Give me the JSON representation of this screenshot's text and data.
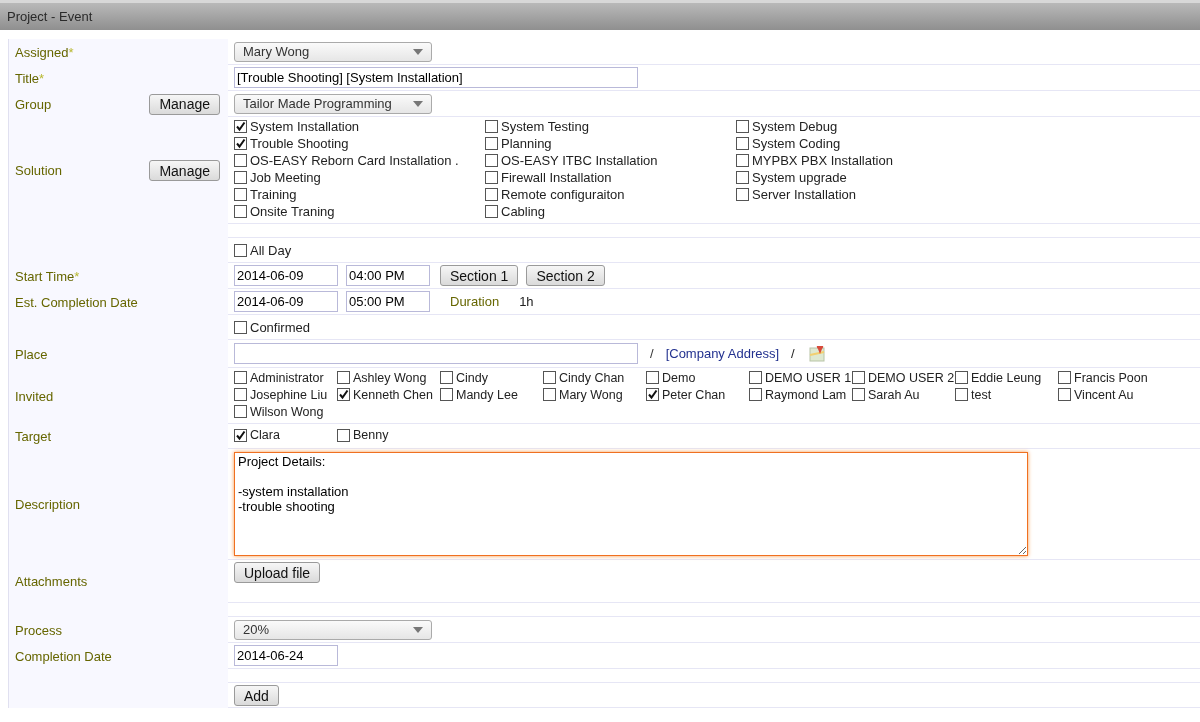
{
  "window": {
    "title": "Project - Event"
  },
  "rows": [
    {
      "kind": "select",
      "label": "Assigned",
      "required_mark": "*",
      "value": "Mary Wong"
    },
    {
      "kind": "text",
      "label": "Title",
      "required_mark": "*",
      "value": "[Trouble Shooting] [System Installation]"
    },
    {
      "kind": "select",
      "label": "Group",
      "button": "Manage",
      "value": "Tailor Made Programming"
    },
    {
      "kind": "checks",
      "label": "Solution",
      "button": "Manage",
      "options": [
        {
          "label": "System Installation",
          "checked": true
        },
        {
          "label": "System Testing",
          "checked": false
        },
        {
          "label": "System Debug",
          "checked": false
        },
        {
          "label": "Trouble Shooting",
          "checked": true
        },
        {
          "label": "Planning",
          "checked": false
        },
        {
          "label": "System Coding",
          "checked": false
        },
        {
          "label": "OS-EASY Reborn Card Installation .",
          "checked": false
        },
        {
          "label": "OS-EASY ITBC Installation",
          "checked": false
        },
        {
          "label": "MYPBX PBX Installation",
          "checked": false
        },
        {
          "label": "Job Meeting",
          "checked": false
        },
        {
          "label": "Firewall Installation",
          "checked": false
        },
        {
          "label": "System upgrade",
          "checked": false
        },
        {
          "label": "Training",
          "checked": false
        },
        {
          "label": "Remote configuraiton",
          "checked": false
        },
        {
          "label": "Server Installation",
          "checked": false
        },
        {
          "label": "Onsite Traning",
          "checked": false
        },
        {
          "label": "Cabling",
          "checked": false
        }
      ]
    },
    {
      "kind": "spacer"
    },
    {
      "kind": "check",
      "option": {
        "label": "All Day",
        "checked": false
      }
    },
    {
      "kind": "datetime",
      "label": "Start Time",
      "required_mark": "*",
      "date": "2014-06-09",
      "time": "04:00 PM",
      "buttons": [
        "Section 1",
        "Section 2"
      ]
    },
    {
      "kind": "datetime",
      "label": "Est. Completion Date",
      "date": "2014-06-09",
      "time": "05:00 PM",
      "duration_label": "Duration",
      "duration": "1h"
    },
    {
      "kind": "check",
      "option": {
        "label": "Confirmed",
        "checked": false
      }
    },
    {
      "kind": "place",
      "label": "Place",
      "separator_1": "/",
      "link": "[Company Address]",
      "separator_2": "/"
    },
    {
      "kind": "people",
      "label": "Invited",
      "options": [
        {
          "label": "Administrator",
          "checked": false
        },
        {
          "label": "Ashley Wong",
          "checked": false
        },
        {
          "label": "Cindy",
          "checked": false
        },
        {
          "label": "Cindy Chan",
          "checked": false
        },
        {
          "label": "Demo",
          "checked": false
        },
        {
          "label": "DEMO USER 1",
          "checked": false
        },
        {
          "label": "DEMO USER 2",
          "checked": false
        },
        {
          "label": "Eddie Leung",
          "checked": false
        },
        {
          "label": "Francis Poon",
          "checked": false
        },
        {
          "label": "Josephine Liu",
          "checked": false
        },
        {
          "label": "Kenneth Chen",
          "checked": true
        },
        {
          "label": "Mandy Lee",
          "checked": false
        },
        {
          "label": "Mary Wong",
          "checked": false
        },
        {
          "label": "Peter Chan",
          "checked": true
        },
        {
          "label": "Raymond Lam",
          "checked": false
        },
        {
          "label": "Sarah Au",
          "checked": false
        },
        {
          "label": "test",
          "checked": false
        },
        {
          "label": "Vincent Au",
          "checked": false
        },
        {
          "label": "Wilson Wong",
          "checked": false
        }
      ]
    },
    {
      "kind": "people",
      "label": "Target",
      "options": [
        {
          "label": "Clara",
          "checked": true
        },
        {
          "label": "Benny",
          "checked": false
        }
      ]
    },
    {
      "kind": "textarea",
      "label": "Description",
      "value": "Project Details:\n\n-system installation\n-trouble shooting"
    },
    {
      "kind": "button",
      "label": "Attachments",
      "button": "Upload file"
    },
    {
      "kind": "spacer"
    },
    {
      "kind": "select",
      "label": "Process",
      "value": "20%"
    },
    {
      "kind": "date",
      "label": "Completion Date",
      "value": "2014-06-24"
    },
    {
      "kind": "spacer"
    },
    {
      "kind": "button",
      "button": "Add"
    }
  ]
}
